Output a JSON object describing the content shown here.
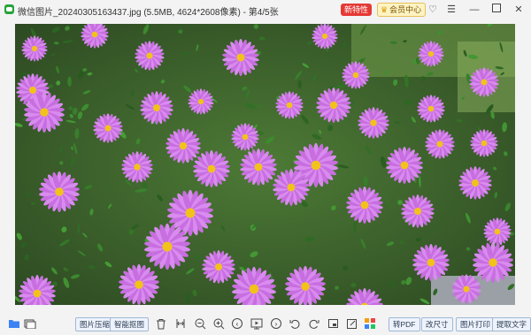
{
  "window": {
    "title": "微信图片_20240305163437.jpg (5.5MB, 4624*2608像素) - 第4/5张",
    "badge_new": "新特性",
    "badge_vip": "会员中心",
    "icons": [
      "heart-icon",
      "list-icon",
      "minimize-icon",
      "maximize-icon",
      "close-icon"
    ]
  },
  "photo": {
    "subject": ""
  },
  "toolbar": {
    "compress_label": "图片压缩",
    "smart_cutout_label": "智能抠图",
    "to_pdf_label": "转PDF",
    "resize_label": "改尺寸",
    "print_label": "图片打印",
    "extract_text_label": "提取文字"
  },
  "colors": {
    "accent_red": "#e53935",
    "button_border": "#9fb7d6"
  }
}
